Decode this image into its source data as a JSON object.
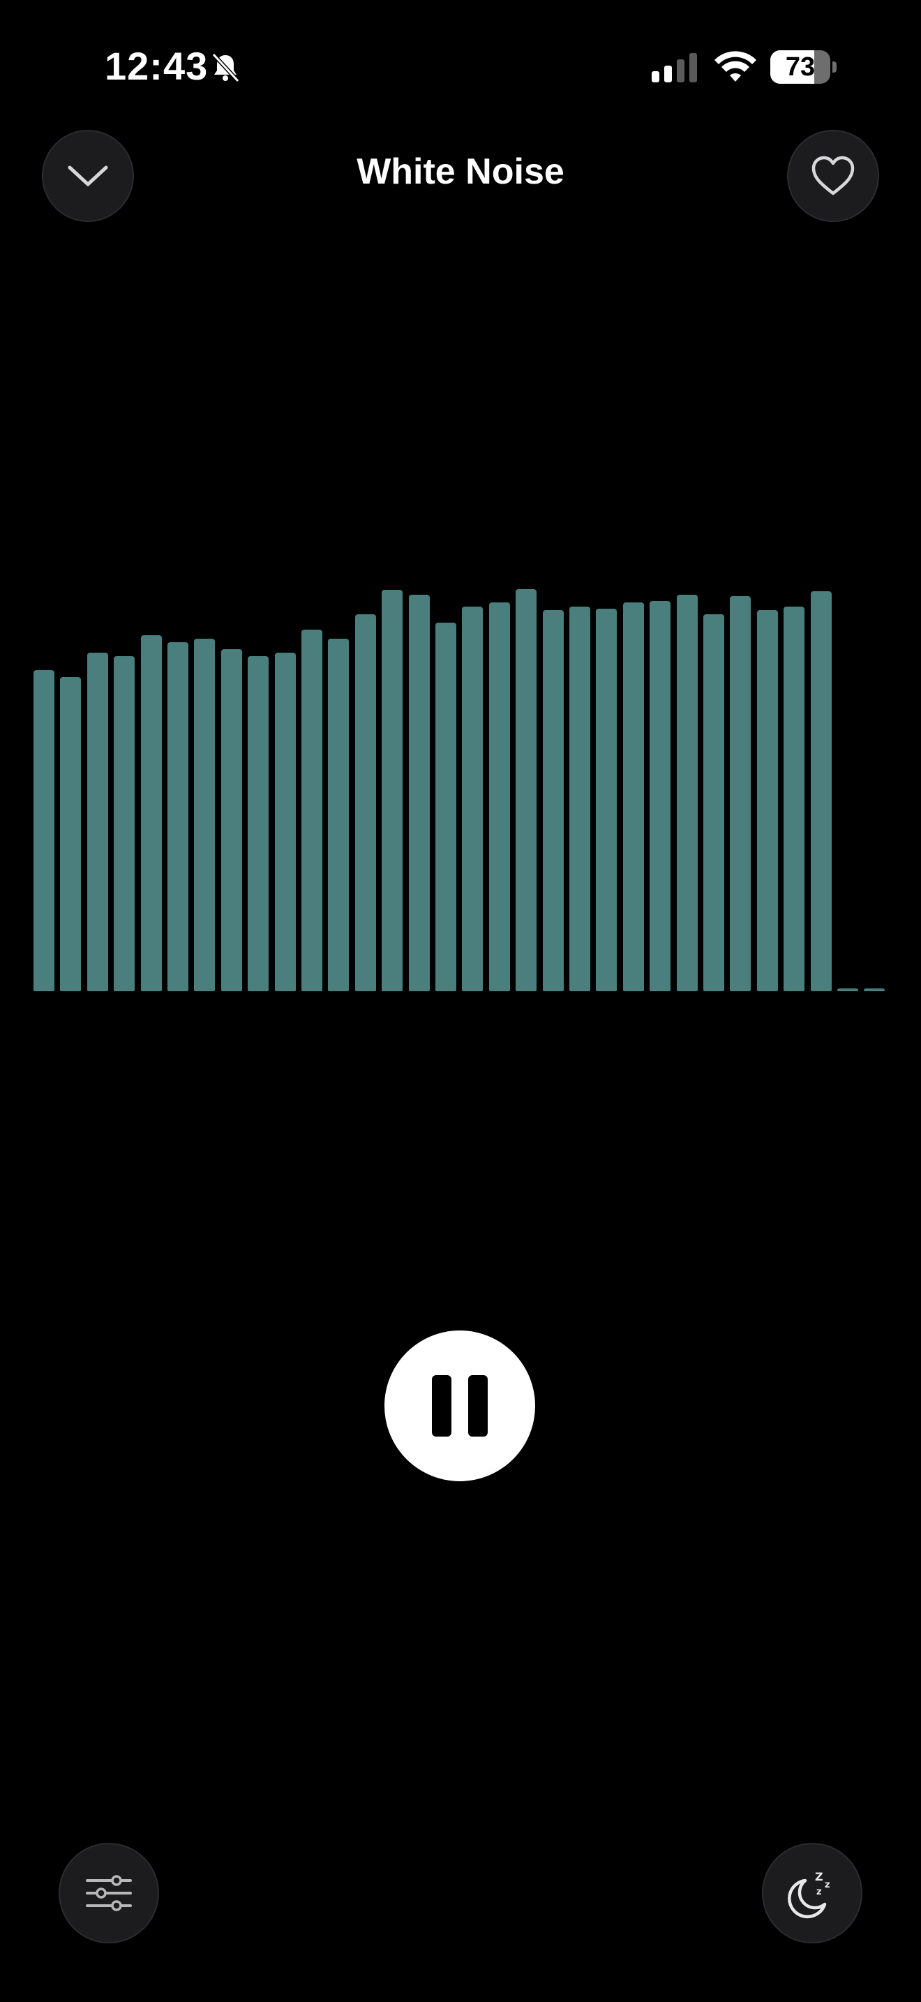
{
  "status_bar": {
    "time": "12:43",
    "battery_level": "73",
    "battery_fraction": 0.73,
    "icons": [
      "bell-slash-icon",
      "cellular-signal-icon",
      "wifi-icon",
      "battery-icon"
    ]
  },
  "header": {
    "title": "White Noise",
    "left_icon": "chevron-down-icon",
    "right_icon": "heart-icon"
  },
  "visualizer": {
    "color": "#4a7f7d",
    "levels": [
      0.46,
      0.45,
      0.485,
      0.48,
      0.51,
      0.5,
      0.505,
      0.49,
      0.48,
      0.485,
      0.518,
      0.505,
      0.54,
      0.575,
      0.568,
      0.528,
      0.551,
      0.557,
      0.576,
      0.546,
      0.551,
      0.548,
      0.557,
      0.559,
      0.568,
      0.54,
      0.566,
      0.546,
      0.551,
      0.573,
      0.004,
      0.004
    ]
  },
  "controls": {
    "play_state": "playing",
    "pause_icon": "pause-icon",
    "mixer_icon": "sliders-icon",
    "sleep_icon": "moon-zzz-icon"
  },
  "colors": {
    "background": "#000000",
    "button_bg": "#1c1c1e",
    "accent_bar": "#4a7f7d"
  }
}
